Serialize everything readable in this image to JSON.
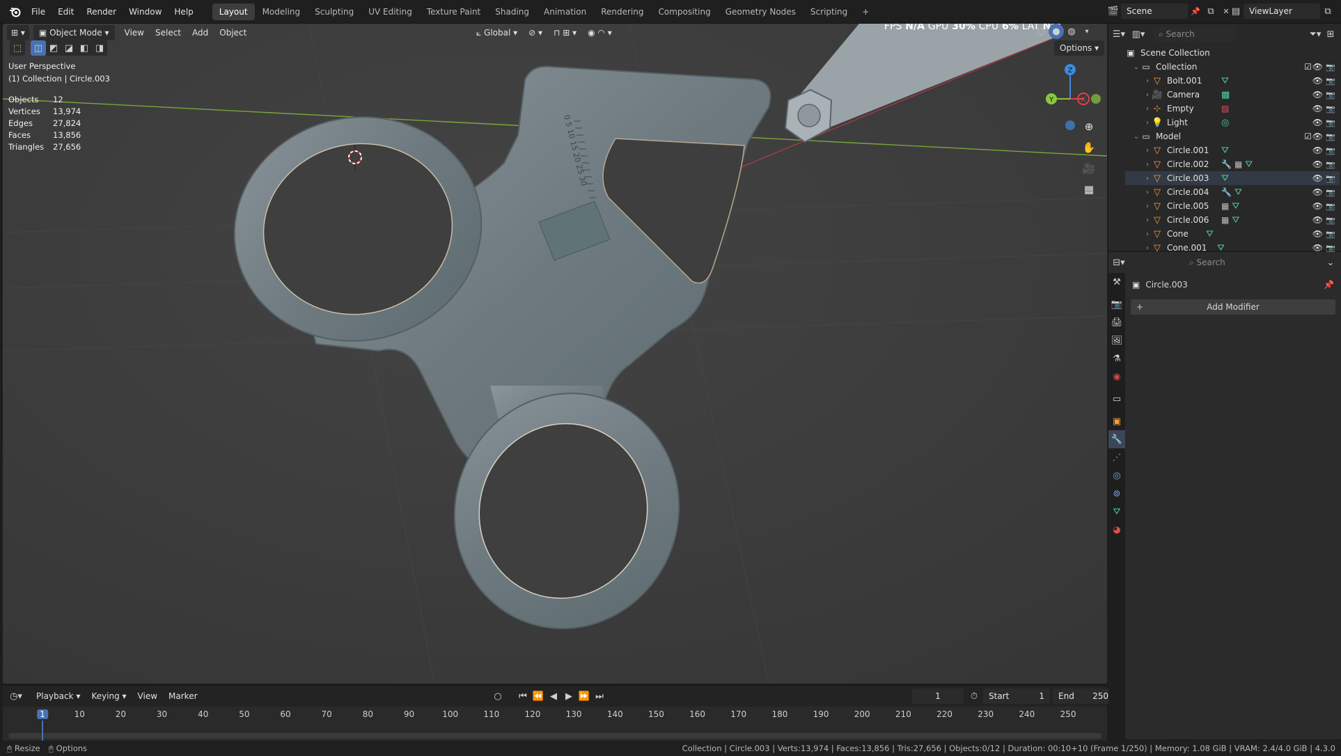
{
  "menus": [
    "File",
    "Edit",
    "Render",
    "Window",
    "Help"
  ],
  "workspaces": [
    "Layout",
    "Modeling",
    "Sculpting",
    "UV Editing",
    "Texture Paint",
    "Shading",
    "Animation",
    "Rendering",
    "Compositing",
    "Geometry Nodes",
    "Scripting",
    "+"
  ],
  "active_workspace": "Layout",
  "scene": "Scene",
  "view_layer": "ViewLayer",
  "viewport": {
    "mode": "Object Mode",
    "menus": [
      "View",
      "Select",
      "Add",
      "Object"
    ],
    "orientation": "Global",
    "options": "Options",
    "perspective": "User Perspective",
    "context": "(1) Collection | Circle.003",
    "stats": [
      {
        "label": "Objects",
        "value": "12"
      },
      {
        "label": "Vertices",
        "value": "13,974"
      },
      {
        "label": "Edges",
        "value": "27,824"
      },
      {
        "label": "Faces",
        "value": "13,856"
      },
      {
        "label": "Triangles",
        "value": "27,656"
      }
    ],
    "overlay_stats": {
      "fps": "FPS",
      "fps_val": "N/A",
      "gpu": "GPU",
      "gpu_val": "30%",
      "cpu": "CPU",
      "cpu_val": "6%",
      "lat": "LAT",
      "lat_val": "N/A"
    },
    "ruler_marks": "0 5 10 15 20 25 30",
    "axes": {
      "x": "X",
      "y": "Y",
      "z": "Z"
    }
  },
  "outliner": {
    "search_placeholder": "Search",
    "root": "Scene Collection",
    "collections": [
      {
        "name": "Collection",
        "items": [
          {
            "name": "Bolt.001",
            "type": "mesh"
          },
          {
            "name": "Camera",
            "type": "camera"
          },
          {
            "name": "Empty",
            "type": "empty"
          },
          {
            "name": "Light",
            "type": "light"
          }
        ]
      },
      {
        "name": "Model",
        "items": [
          {
            "name": "Circle.001",
            "type": "mesh"
          },
          {
            "name": "Circle.002",
            "type": "mesh"
          },
          {
            "name": "Circle.003",
            "type": "mesh"
          },
          {
            "name": "Circle.004",
            "type": "mesh"
          },
          {
            "name": "Circle.005",
            "type": "mesh"
          },
          {
            "name": "Circle.006",
            "type": "mesh"
          },
          {
            "name": "Cone",
            "type": "mesh"
          },
          {
            "name": "Cone.001",
            "type": "mesh"
          }
        ]
      }
    ]
  },
  "properties": {
    "search_placeholder": "Search",
    "object_name": "Circle.003",
    "add_modifier": "Add Modifier"
  },
  "timeline": {
    "menus": [
      "Playback",
      "Keying",
      "View",
      "Marker"
    ],
    "current_frame": "1",
    "start_label": "Start",
    "start": "1",
    "end_label": "End",
    "end": "250",
    "ticks": [
      "1",
      "10",
      "20",
      "30",
      "40",
      "50",
      "60",
      "70",
      "80",
      "90",
      "100",
      "110",
      "120",
      "130",
      "140",
      "150",
      "160",
      "170",
      "180",
      "190",
      "200",
      "210",
      "220",
      "230",
      "240",
      "250"
    ]
  },
  "status": {
    "left1": "Resize",
    "left2": "Options",
    "right": "Collection | Circle.003 | Verts:13,974 | Faces:13,856 | Tris:27,656 | Objects:0/12 | Duration: 00:10+10 (Frame 1/250) | Memory: 1.08 GiB | VRAM: 2.4/4.0 GiB | 4.3.0"
  },
  "colors": {
    "accent": "#4772b3",
    "mesh": "#4fd09b",
    "object": "#ff9b3a",
    "x_axis": "#e0404f",
    "y_axis": "#8bc640",
    "z_axis": "#3f8bdc"
  }
}
